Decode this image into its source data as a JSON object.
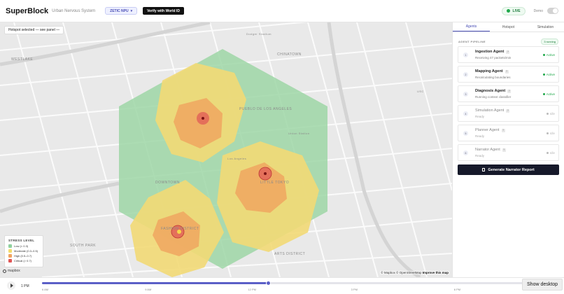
{
  "header": {
    "brand": "SuperBlock",
    "brand_sub": "Urban Nervous System",
    "city_chip": "ZETIC NPU",
    "verify_label": "Verify with World ID",
    "live_label": "LIVE",
    "demo_label": "Demo"
  },
  "map": {
    "hotspot_chip": "Hotspot selected — see panel —",
    "legend": {
      "title": "STRESS LEVEL",
      "items": [
        {
          "label": "Low (< 0.3)",
          "color": "#8fd19e"
        },
        {
          "label": "Moderate (0.3–0.5)",
          "color": "#f3dc6b"
        },
        {
          "label": "High (0.5–0.7)",
          "color": "#f0a35e"
        },
        {
          "label": "Critical (> 0.7)",
          "color": "#e05555"
        }
      ]
    },
    "mapbox_logo": "mapbox",
    "attribution": "© Mapbox © OpenStreetMap",
    "attribution_link": "Improve this map",
    "labels": [
      "CHINATOWN",
      "WESTLAKE",
      "PUEBLO DE LOS ANGELES",
      "DOWNTOWN",
      "LITTLE TOKYO",
      "FASHION DISTRICT",
      "ARTS DISTRICT",
      "SOUTH PARK",
      "Los Angeles",
      "Union Station",
      "USC",
      "Dodger Stadium"
    ]
  },
  "timeline": {
    "time_label": "1 PM",
    "progress": 0.44,
    "ticks": [
      "6 AM",
      "9 AM",
      "12 PM",
      "3 PM",
      "6 PM",
      "9 PM"
    ],
    "show_desktop": "Show desktop"
  },
  "panel": {
    "tabs": [
      {
        "label": "Agents",
        "active": true
      },
      {
        "label": "Hotspot",
        "active": false
      },
      {
        "label": "Simulation",
        "active": false
      }
    ],
    "section_title": "AGENT PIPELINE",
    "running_badge": "3 running",
    "agents": [
      {
        "idx": "1",
        "name": "Ingestion Agent",
        "desc": "Receiving 47 packets/min",
        "status": "Active",
        "active": true
      },
      {
        "idx": "2",
        "name": "Mapping Agent",
        "desc": "Recalculating boundaries",
        "status": "Active",
        "active": true
      },
      {
        "idx": "3",
        "name": "Diagnosis Agent",
        "desc": "Running context classifier",
        "status": "Active",
        "active": true
      },
      {
        "idx": "4",
        "name": "Simulation Agent",
        "desc": "Ready",
        "status": "Idle",
        "active": false
      },
      {
        "idx": "5",
        "name": "Planner Agent",
        "desc": "Ready",
        "status": "Idle",
        "active": false
      },
      {
        "idx": "6",
        "name": "Narrator Agent",
        "desc": "Ready",
        "status": "Idle",
        "active": false
      }
    ],
    "generate_button": "Generate Narrator Report"
  },
  "colors": {
    "accent": "#4a4fb5",
    "active_green": "#1fa84a",
    "idle_gray": "#bbbbbb"
  }
}
